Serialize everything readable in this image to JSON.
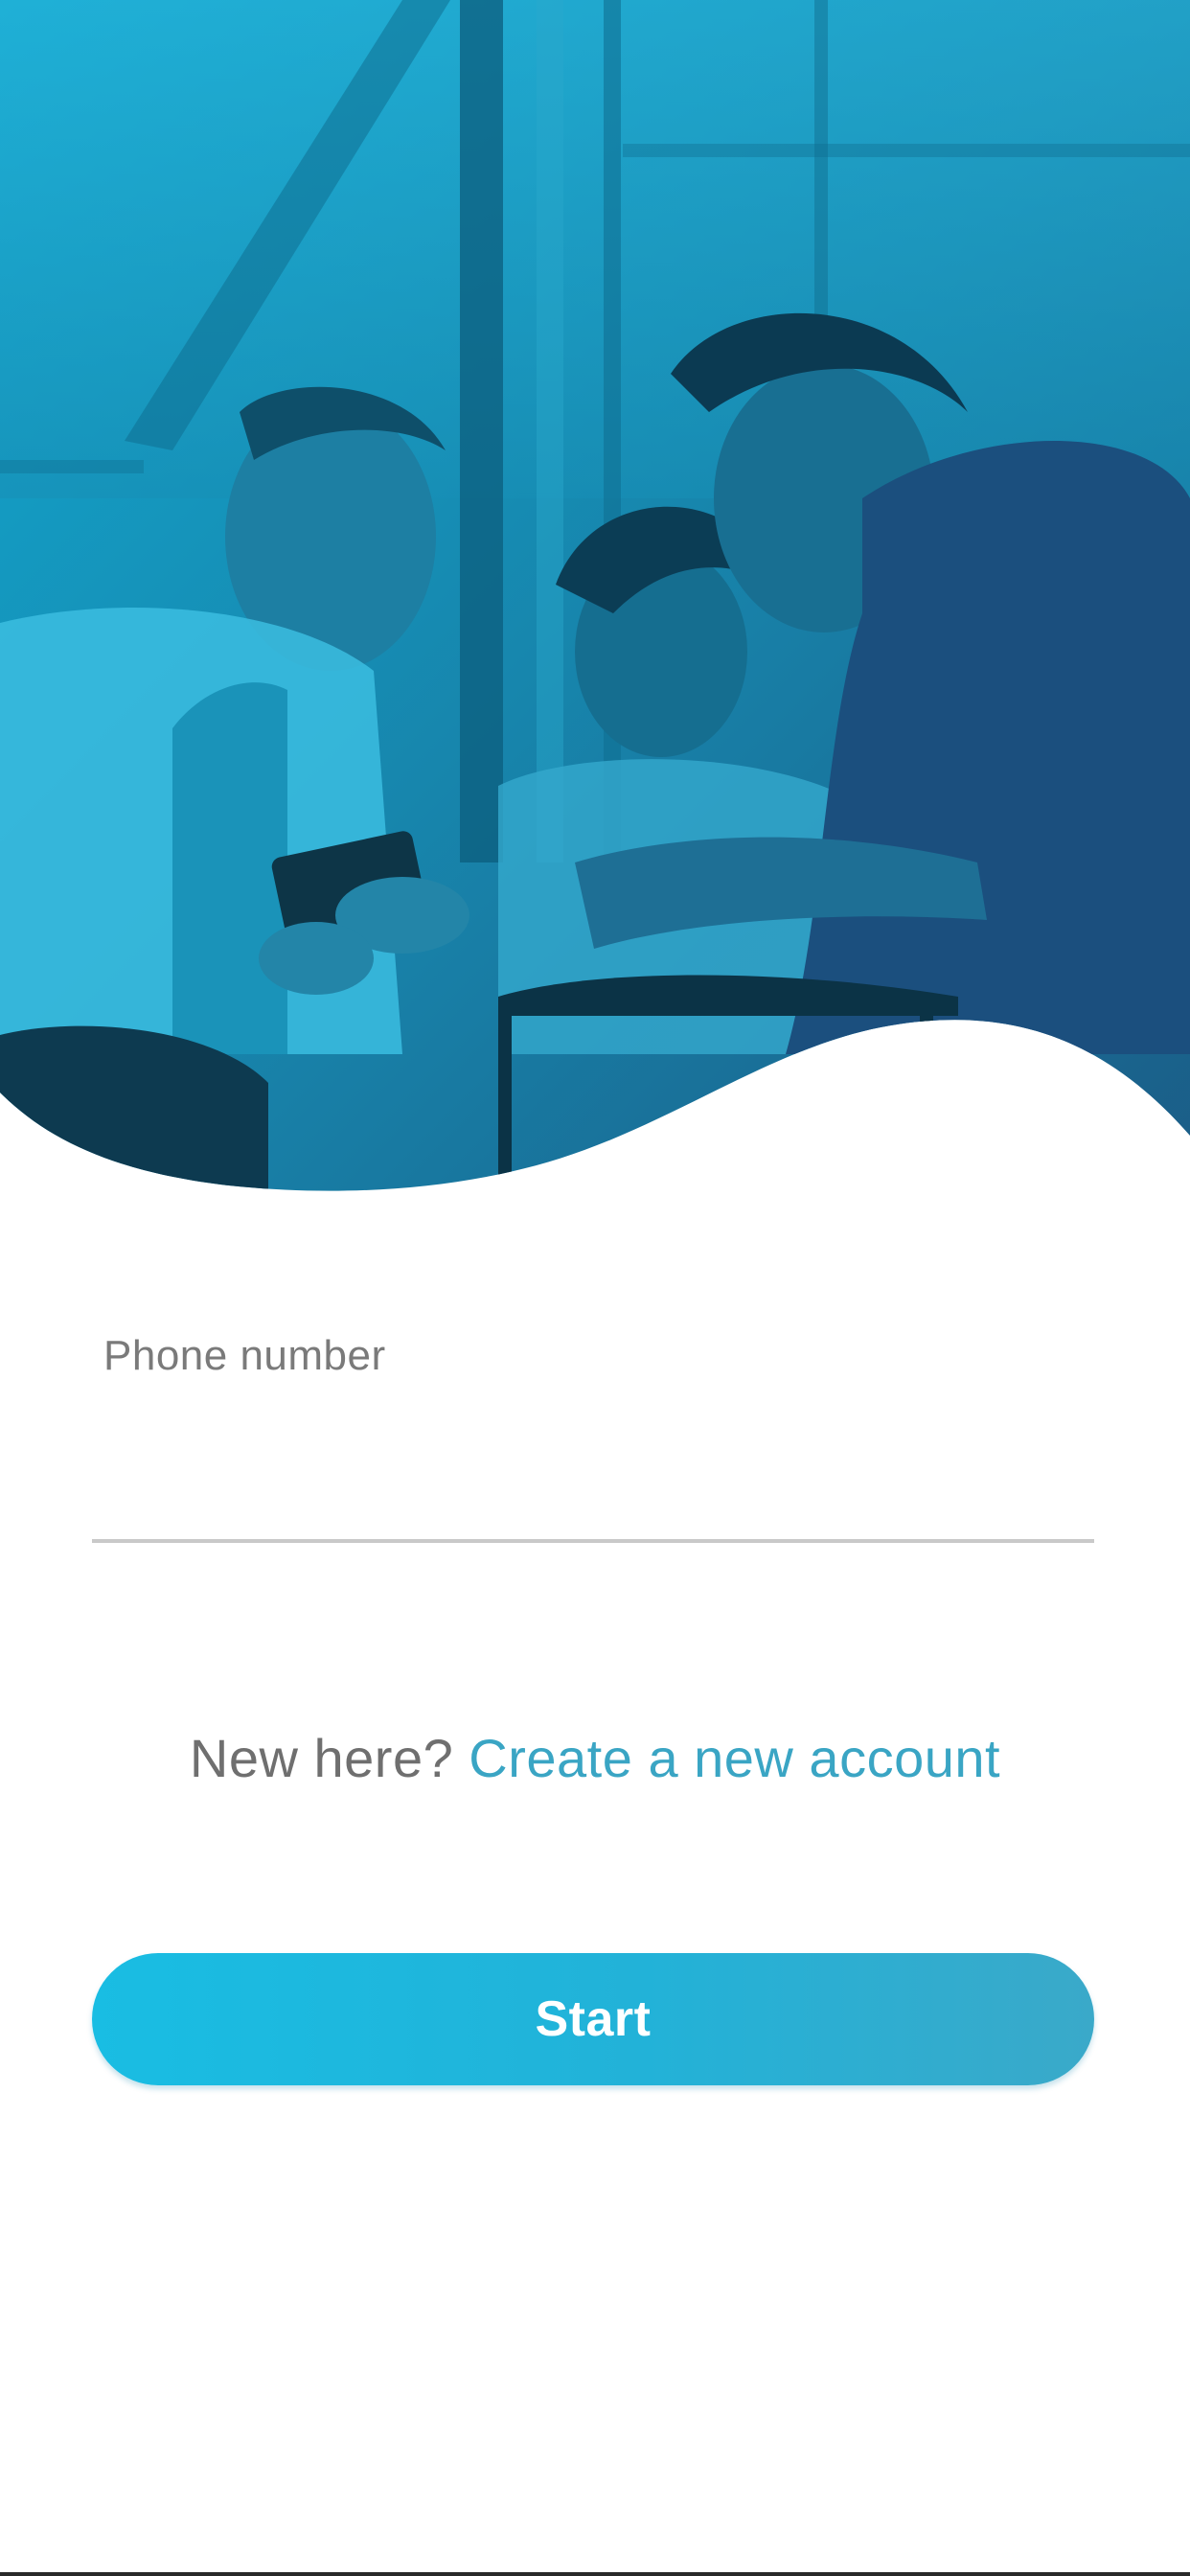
{
  "form": {
    "phone_label": "Phone number",
    "phone_value": "",
    "signup_prompt": "New here?",
    "signup_link": "Create a new account",
    "start_label": "Start"
  },
  "colors": {
    "accent": "#3aa5c4",
    "button_start": "#19bde3",
    "button_end": "#3aa9c9",
    "hero_tint": "#1a8fb0",
    "label_gray": "#7a7a7a"
  },
  "hero": {
    "image_description_icon": "hero-photo"
  }
}
